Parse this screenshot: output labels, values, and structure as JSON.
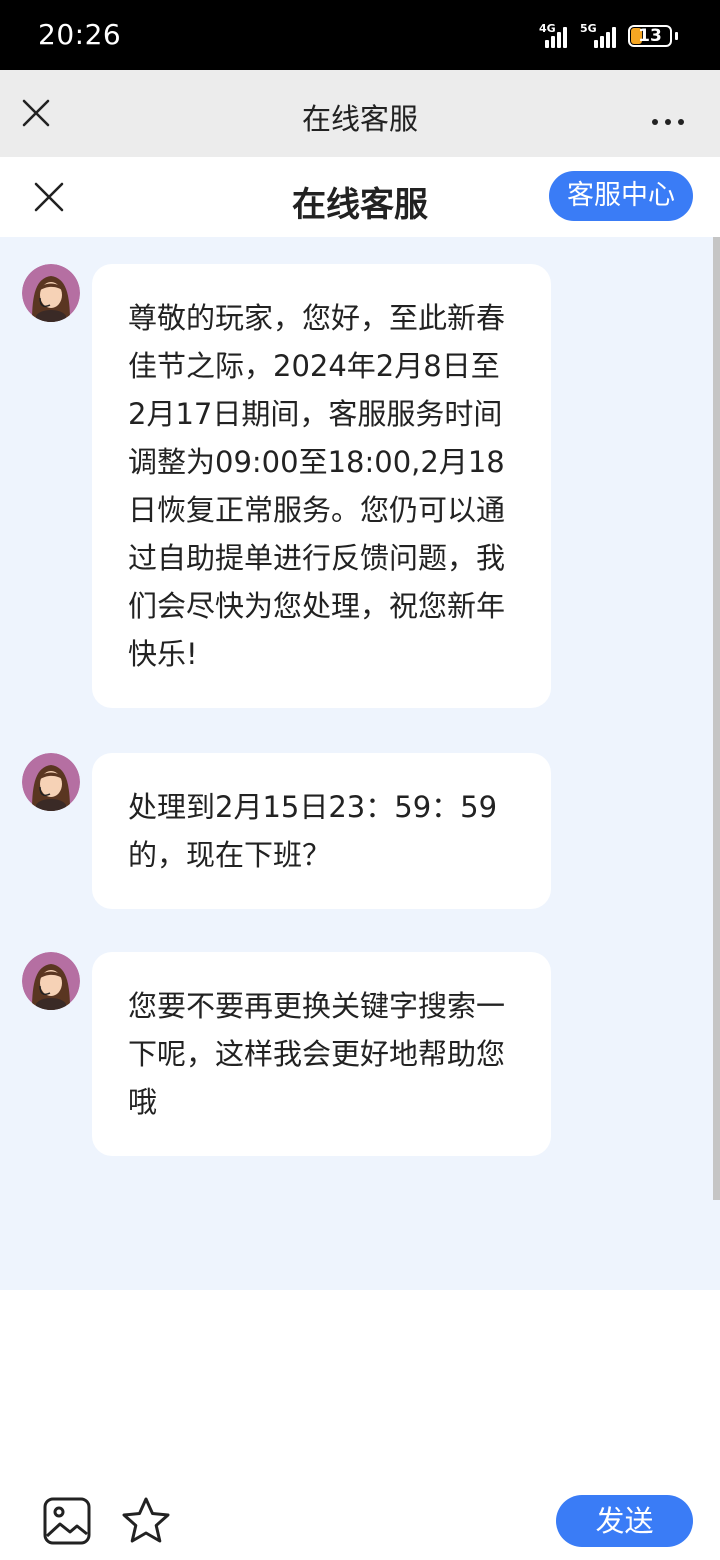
{
  "status_bar": {
    "time": "20:26",
    "network_1": "4G",
    "network_2": "5G",
    "battery_level": "13",
    "battery_color": "#f5a623"
  },
  "browser_header": {
    "title": "在线客服",
    "close_icon": "close-icon",
    "more_icon": "more-icon"
  },
  "page_header": {
    "title": "在线客服",
    "close_icon": "close-icon",
    "service_center_label": "客服中心",
    "accent_color": "#3a7cf6"
  },
  "messages": [
    {
      "sender": "agent",
      "text": "尊敬的玩家，您好，至此新春佳节之际，2024年2月8日至2月17日期间，客服服务时间调整为09:00至18:00,2月18日恢复正常服务。您仍可以通过自助提单进行反馈问题，我们会尽快为您处理，祝您新年快乐!"
    },
    {
      "sender": "agent",
      "text": "处理到2月15日23：59：59的，现在下班？"
    },
    {
      "sender": "agent",
      "text": "您要不要再更换关键字搜索一下呢，这样我会更好地帮助您哦"
    }
  ],
  "bottom_bar": {
    "image_icon": "image-icon",
    "favorite_icon": "star-icon",
    "send_label": "发送"
  }
}
